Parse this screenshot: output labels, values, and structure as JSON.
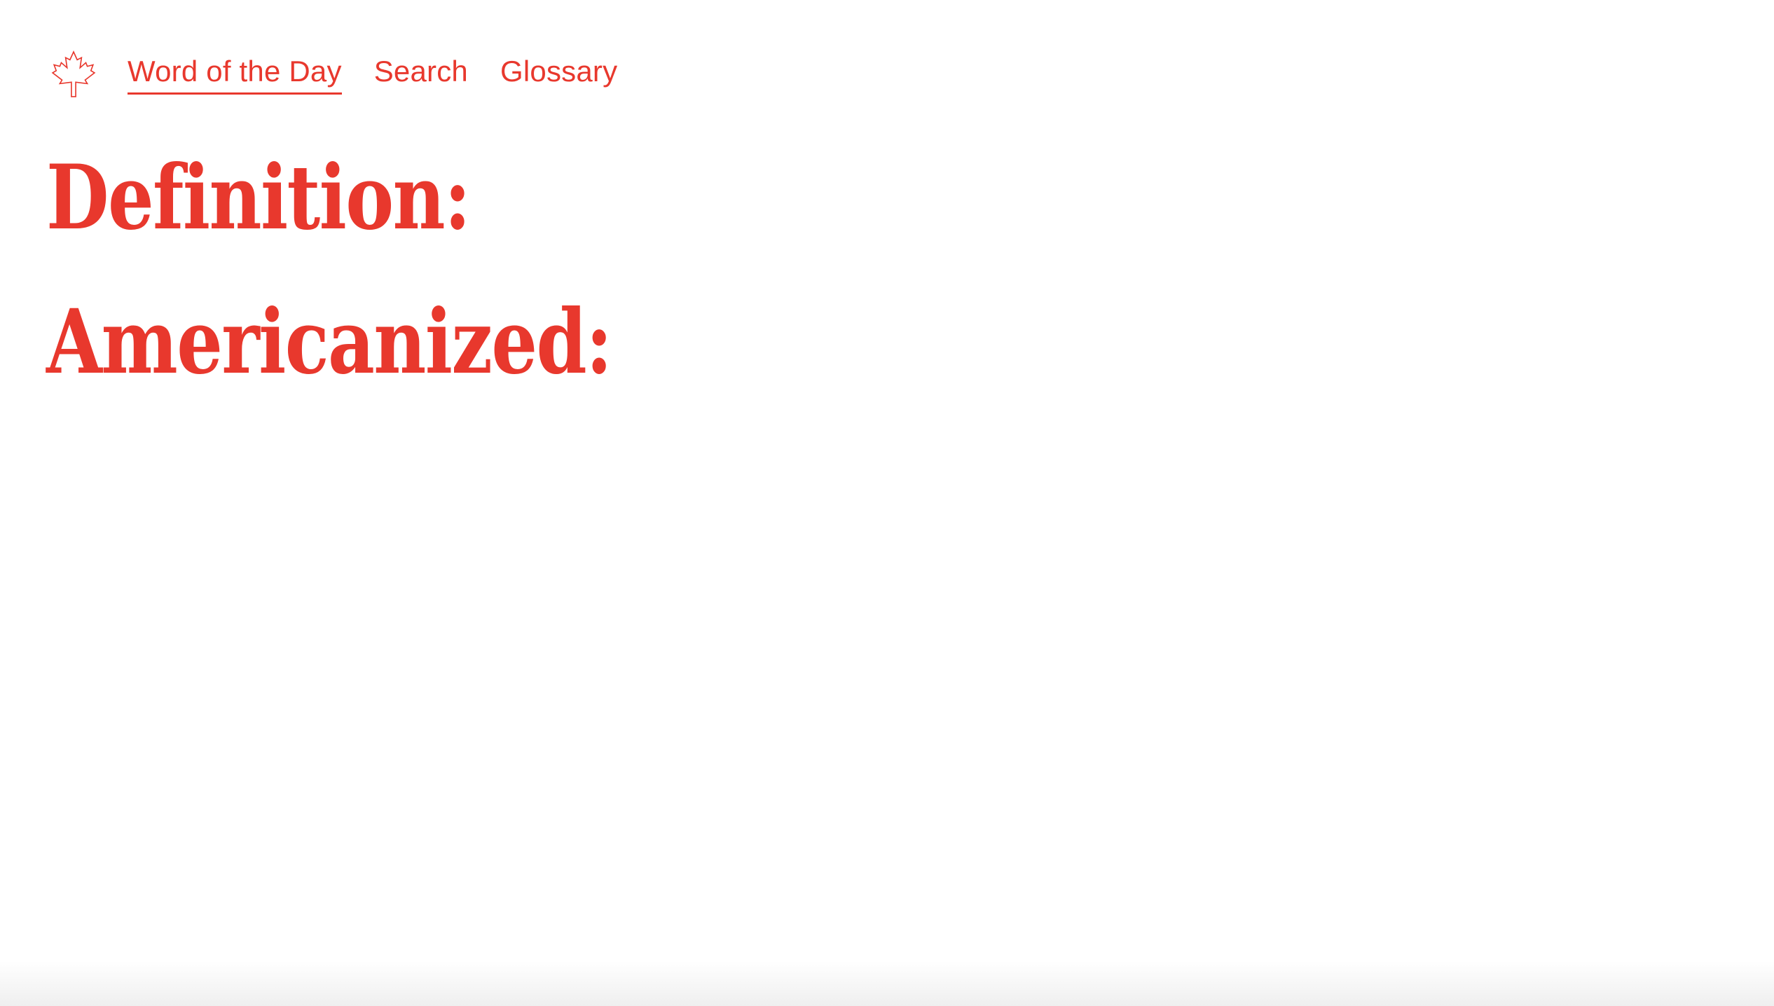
{
  "nav": {
    "logo_icon": "maple-leaf-icon",
    "items": [
      {
        "label": "Word of the Day",
        "active": true
      },
      {
        "label": "Search",
        "active": false
      },
      {
        "label": "Glossary",
        "active": false
      }
    ]
  },
  "main": {
    "definition_label": "Definition:",
    "americanized_label": "Americanized:"
  },
  "colors": {
    "accent": "#e8382d",
    "background": "#ffffff"
  }
}
